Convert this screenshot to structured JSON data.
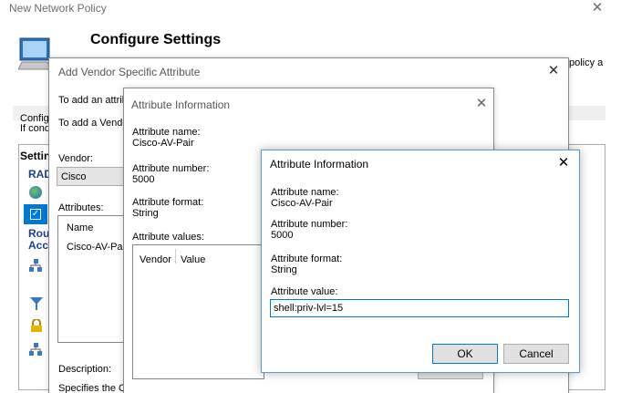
{
  "main_window": {
    "title": "New Network Policy",
    "heading": "Configure Settings",
    "right_fragment": "policy a",
    "configure_text_1": "Configu",
    "configure_text_2": "If cond",
    "settings_label": "Settin",
    "sidebar_items": [
      "RAD",
      "Rou",
      "Acc"
    ]
  },
  "vendor_dialog": {
    "title": "Add Vendor Specific Attribute",
    "instruction_1": "To add an attrib",
    "instruction_2": "To add a Vendo",
    "vendor_label": "Vendor:",
    "vendor_value": "Cisco",
    "attributes_label": "Attributes:",
    "attributes_columns": [
      "Name"
    ],
    "attributes_rows": [
      "Cisco-AV-Pair"
    ],
    "description_label": "Description:",
    "description_text": "Specifies the Ci"
  },
  "attribute_info_outer": {
    "title": "Attribute Information",
    "name_label": "Attribute name:",
    "name_value": "Cisco-AV-Pair",
    "number_label": "Attribute number:",
    "number_value": "5000",
    "format_label": "Attribute format:",
    "format_value": "String",
    "values_label": "Attribute values:",
    "values_columns": [
      "Vendor",
      "Value"
    ]
  },
  "attribute_info_inner": {
    "title": "Attribute Information",
    "name_label": "Attribute name:",
    "name_value": "Cisco-AV-Pair",
    "number_label": "Attribute number:",
    "number_value": "5000",
    "format_label": "Attribute format:",
    "format_value": "String",
    "value_label": "Attribute value:",
    "value_input": "shell:priv-lvl=15",
    "ok_label": "OK",
    "cancel_label": "Cancel"
  },
  "icons": {
    "close": "close-icon",
    "computer": "computer-icon"
  }
}
